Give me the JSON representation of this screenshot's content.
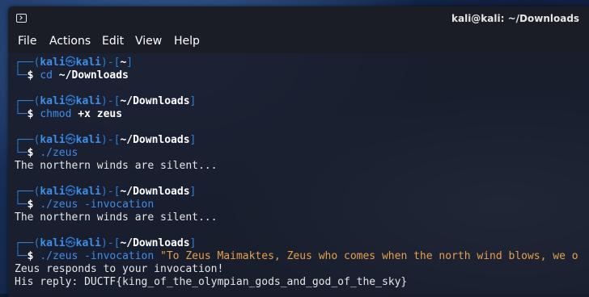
{
  "window": {
    "title": "kali@kali: ~/Downloads"
  },
  "menu": {
    "items": [
      "File",
      "Actions",
      "Edit",
      "View",
      "Help"
    ]
  },
  "prompt": {
    "user": "kali",
    "host": "kali",
    "separator": "㉿"
  },
  "blocks": [
    {
      "path": "~",
      "command": "cd",
      "args": " ~/Downloads",
      "output": []
    },
    {
      "path": "~/Downloads",
      "command": "chmod",
      "args": " +x zeus",
      "output": []
    },
    {
      "path": "~/Downloads",
      "command": "./zeus",
      "args": "",
      "output": [
        "The northern winds are silent..."
      ]
    },
    {
      "path": "~/Downloads",
      "command": "./zeus",
      "args": " -invocation",
      "output": [
        "The northern winds are silent..."
      ]
    },
    {
      "path": "~/Downloads",
      "command": "./zeus",
      "args": " -invocation",
      "string_arg": " \"To Zeus Maimaktes, Zeus who comes when the north wind blows, we o",
      "output": [
        "Zeus responds to your invocation!",
        "His reply: DUCTF{king_of_the_olympian_gods_and_god_of_the_sky}"
      ]
    }
  ]
}
